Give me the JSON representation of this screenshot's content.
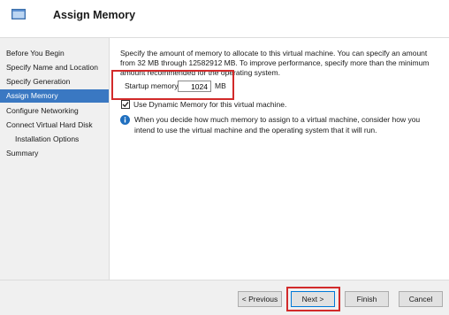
{
  "header": {
    "title": "Assign Memory"
  },
  "nav": {
    "items": [
      {
        "label": "Before You Begin"
      },
      {
        "label": "Specify Name and Location"
      },
      {
        "label": "Specify Generation"
      },
      {
        "label": "Assign Memory"
      },
      {
        "label": "Configure Networking"
      },
      {
        "label": "Connect Virtual Hard Disk"
      },
      {
        "label": "Installation Options"
      },
      {
        "label": "Summary"
      }
    ],
    "active_index": 3
  },
  "main": {
    "description": "Specify the amount of memory to allocate to this virtual machine. You can specify an amount from 32 MB through 12582912 MB. To improve performance, specify more than the minimum amount recommended for the operating system.",
    "startup_memory_label": "Startup memory:",
    "startup_memory_value": "1024",
    "startup_memory_unit": "MB",
    "dynamic_memory_label": "Use Dynamic Memory for this virtual machine.",
    "dynamic_memory_checked": true,
    "info_text": "When you decide how much memory to assign to a virtual machine, consider how you intend to use the virtual machine and the operating system that it will run."
  },
  "footer": {
    "previous_label": "< Previous",
    "next_label": "Next >",
    "finish_label": "Finish",
    "cancel_label": "Cancel"
  },
  "colors": {
    "nav_active": "#3a78c2",
    "highlight": "#d22a2a",
    "info_icon": "#1f6fbf"
  },
  "icons": [
    "window-icon",
    "checkbox-check-icon",
    "info-icon"
  ]
}
